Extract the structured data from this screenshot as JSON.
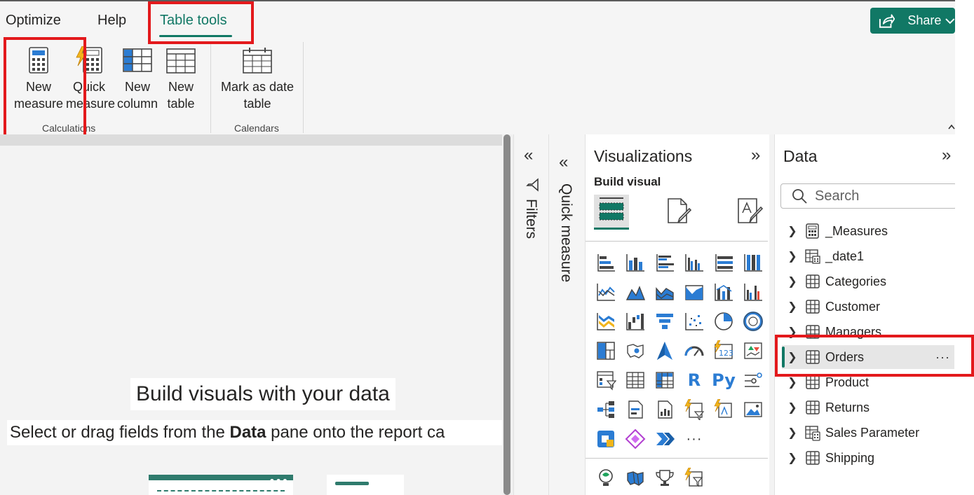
{
  "ribbon": {
    "tabs": [
      {
        "label": "Optimize"
      },
      {
        "label": "Help"
      },
      {
        "label": "Table tools",
        "active": true
      }
    ],
    "share_label": "Share",
    "buttons": {
      "new_measure": [
        "New",
        "measure"
      ],
      "quick_measure": [
        "Quick",
        "measure"
      ],
      "new_column": [
        "New",
        "column"
      ],
      "new_table": [
        "New",
        "table"
      ],
      "mark_date": [
        "Mark as date",
        "table"
      ]
    },
    "groups": {
      "calculations": "Calculations",
      "calendars": "Calendars"
    }
  },
  "canvas": {
    "title": "Build visuals with your data",
    "subtitle_pre": "Select or drag fields from the ",
    "subtitle_bold": "Data",
    "subtitle_post": " pane onto the report ca"
  },
  "panes": {
    "filters_label": "Filters",
    "quick_measure_label": "Quick measure",
    "collapse_glyph": "«",
    "expand_glyph": "»"
  },
  "visualizations": {
    "title": "Visualizations",
    "build_visual": "Build visual",
    "letter_icons": {
      "r": "R",
      "py": "Py"
    },
    "more": "···"
  },
  "data_pane": {
    "title": "Data",
    "search_placeholder": "Search",
    "items": [
      {
        "label": "_Measures",
        "icon": "calculator-table-icon"
      },
      {
        "label": "_date1",
        "icon": "calendar-table-icon"
      },
      {
        "label": "Categories",
        "icon": "table-icon"
      },
      {
        "label": "Customer",
        "icon": "table-icon"
      },
      {
        "label": "Managers",
        "icon": "table-icon"
      },
      {
        "label": "Orders",
        "icon": "table-icon",
        "selected": true
      },
      {
        "label": "Product",
        "icon": "table-icon"
      },
      {
        "label": "Returns",
        "icon": "table-icon"
      },
      {
        "label": "Sales Parameter",
        "icon": "calculator-table-icon"
      },
      {
        "label": "Shipping",
        "icon": "table-icon"
      }
    ],
    "more_options": "···"
  },
  "colors": {
    "accent": "#117865",
    "highlight": "#e3191c",
    "viz_blue": "#2b7cd3"
  }
}
